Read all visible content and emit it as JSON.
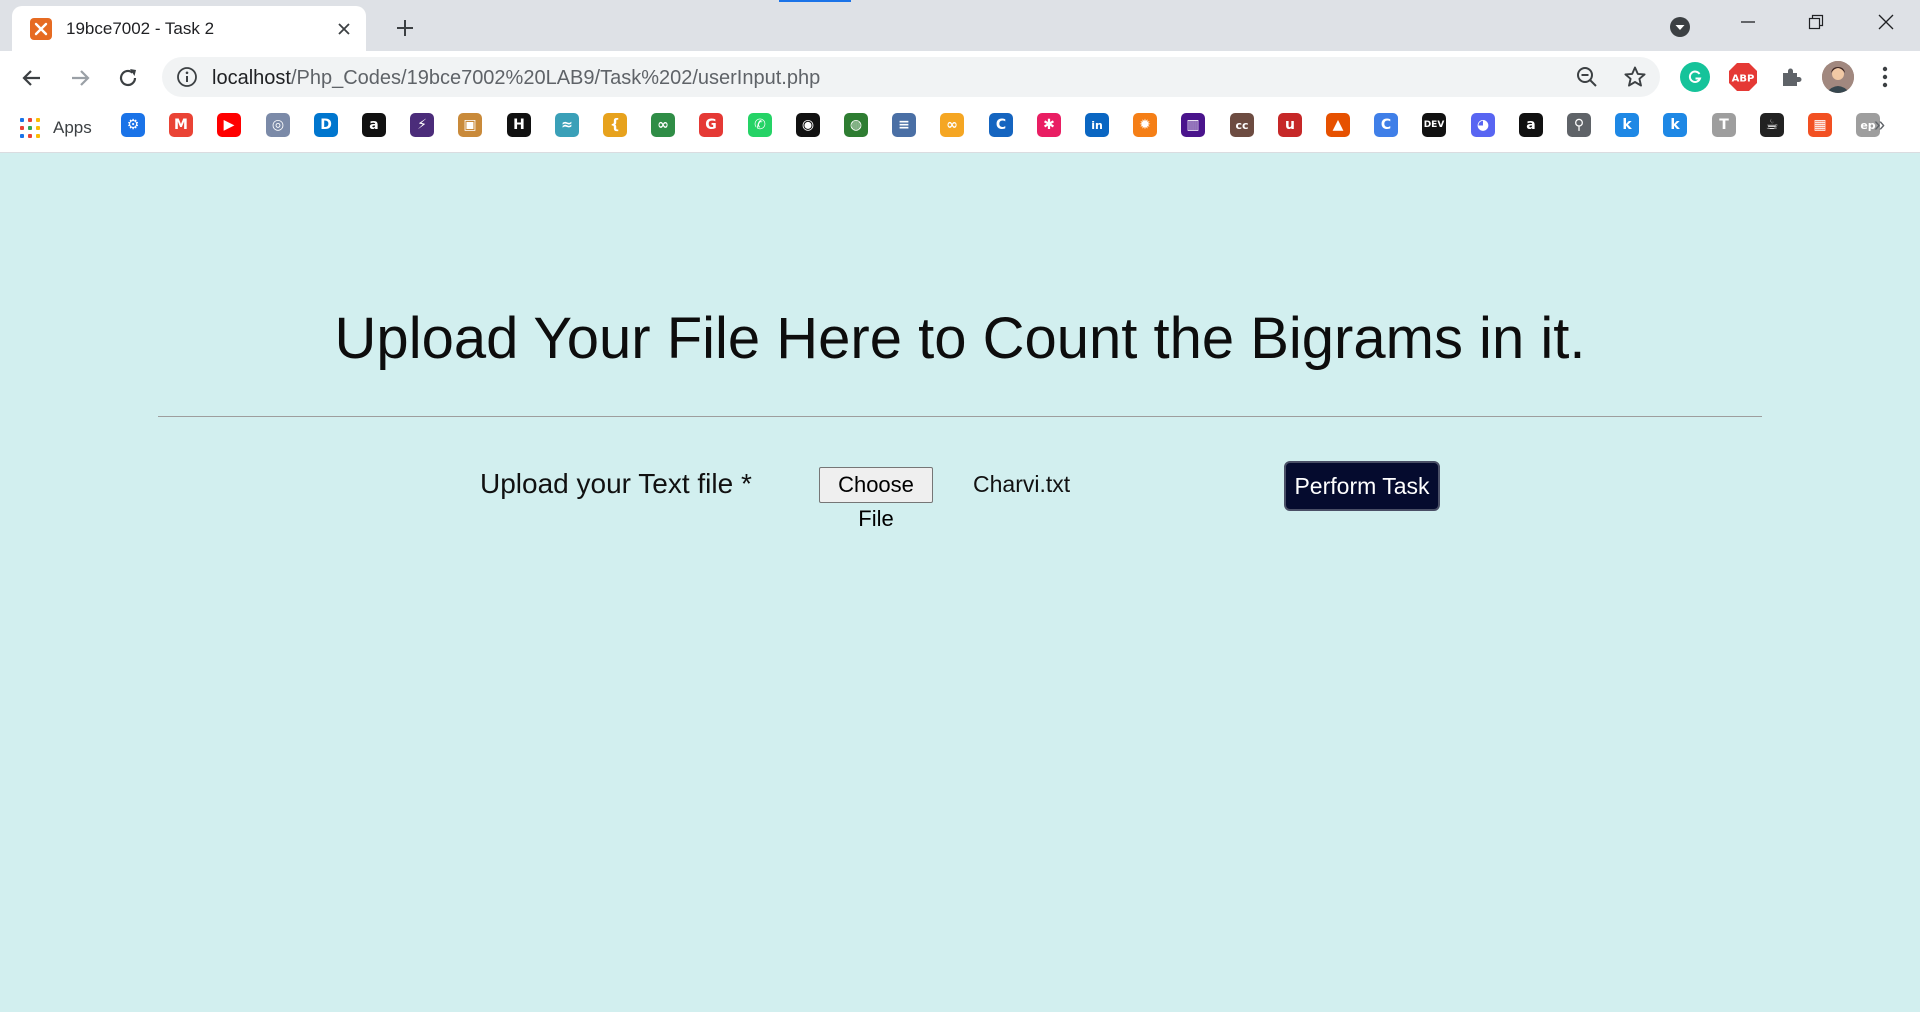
{
  "browser": {
    "tab": {
      "title": "19bce7002 - Task 2",
      "favicon": "xampp-icon"
    },
    "url_host": "localhost",
    "url_path": "/Php_Codes/19bce7002%20LAB9/Task%202/userInput.php",
    "bookmarks_label": "Apps",
    "bookmarks": [
      {
        "icon": "settings-icon",
        "color": "#1a73e8",
        "glyph": "⚙"
      },
      {
        "icon": "gmail-icon",
        "color": "#ea4335",
        "glyph": "M"
      },
      {
        "icon": "youtube-icon",
        "color": "#ff0000",
        "glyph": "▶"
      },
      {
        "icon": "university-icon",
        "color": "#7b8aa8",
        "glyph": "◎"
      },
      {
        "icon": "dell-icon",
        "color": "#0076ce",
        "glyph": "D"
      },
      {
        "icon": "amazon-icon",
        "color": "#111111",
        "glyph": "a"
      },
      {
        "icon": "bolt-icon",
        "color": "#4b2c7a",
        "glyph": "⚡"
      },
      {
        "icon": "tiger-icon",
        "color": "#c98a3a",
        "glyph": "▣"
      },
      {
        "icon": "hackerearth-icon",
        "color": "#111111",
        "glyph": "H"
      },
      {
        "icon": "wave-icon",
        "color": "#3aa0b8",
        "glyph": "≈"
      },
      {
        "icon": "leetcode-icon",
        "color": "#e7a21d",
        "glyph": "{"
      },
      {
        "icon": "geeksforgeeks-icon",
        "color": "#2f8d46",
        "glyph": "∞"
      },
      {
        "icon": "grammarly-g-icon",
        "color": "#e53935",
        "glyph": "G"
      },
      {
        "icon": "whatsapp-icon",
        "color": "#25d366",
        "glyph": "✆"
      },
      {
        "icon": "github-icon",
        "color": "#111111",
        "glyph": "◉"
      },
      {
        "icon": "circle-logo-icon",
        "color": "#2e7d32",
        "glyph": "◍"
      },
      {
        "icon": "stack-icon",
        "color": "#4a6fa5",
        "glyph": "≡"
      },
      {
        "icon": "coursera-icon",
        "color": "#f5a623",
        "glyph": "∞"
      },
      {
        "icon": "c-icon",
        "color": "#1565c0",
        "glyph": "C"
      },
      {
        "icon": "asterisk-icon",
        "color": "#e91e63",
        "glyph": "✱"
      },
      {
        "icon": "linkedin-icon",
        "color": "#0a66c2",
        "glyph": "in"
      },
      {
        "icon": "sun-bug-icon",
        "color": "#f57f17",
        "glyph": "✹"
      },
      {
        "icon": "chart-icon",
        "color": "#4a148c",
        "glyph": "▥"
      },
      {
        "icon": "cc-icon",
        "color": "#6d4c41",
        "glyph": "cc"
      },
      {
        "icon": "udemy-icon",
        "color": "#c62828",
        "glyph": "u"
      },
      {
        "icon": "matlab-icon",
        "color": "#e65100",
        "glyph": "▲"
      },
      {
        "icon": "canva-icon",
        "color": "#3f7fe8",
        "glyph": "C"
      },
      {
        "icon": "dev-icon",
        "color": "#111111",
        "glyph": "DEV"
      },
      {
        "icon": "discord-icon",
        "color": "#5865f2",
        "glyph": "◕"
      },
      {
        "icon": "amazon-icon",
        "color": "#111111",
        "glyph": "a"
      },
      {
        "icon": "magnifier-icon",
        "color": "#5f6368",
        "glyph": "⚲"
      },
      {
        "icon": "k-icon",
        "color": "#1e88e5",
        "glyph": "k"
      },
      {
        "icon": "k-icon",
        "color": "#1e88e5",
        "glyph": "k"
      },
      {
        "icon": "t-icon",
        "color": "#9e9e9e",
        "glyph": "T"
      },
      {
        "icon": "cup-icon",
        "color": "#222222",
        "glyph": "☕"
      },
      {
        "icon": "microsoft-icon",
        "color": "#f25022",
        "glyph": "▦"
      },
      {
        "icon": "ep-icon",
        "color": "#9e9e9e",
        "glyph": "ep"
      }
    ]
  },
  "page": {
    "heading": "Upload Your File Here to Count the Bigrams in it.",
    "upload_label": "Upload your Text file *",
    "choose_file_label": "Choose File",
    "file_name": "Charvi.txt",
    "submit_label": "Perform Task",
    "background": "#d2efef",
    "submit_color": "#050b2e"
  }
}
